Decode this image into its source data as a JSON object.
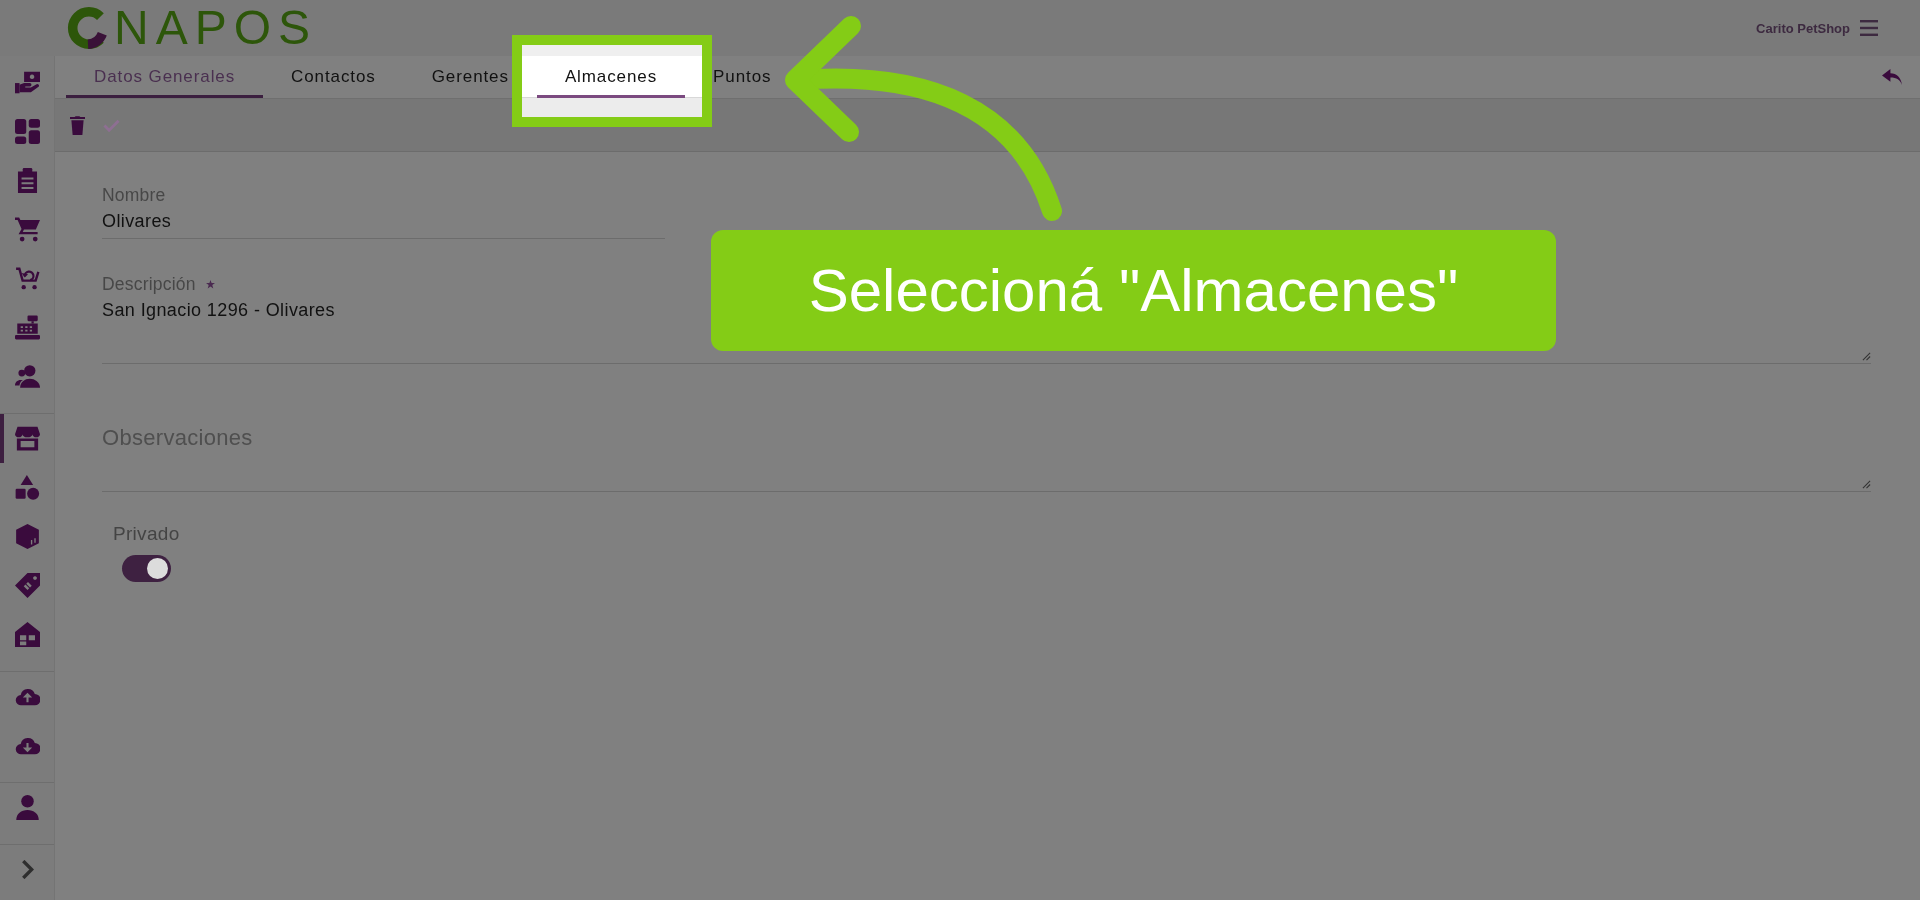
{
  "header": {
    "logo": "NAPOS",
    "account": "Carito PetShop"
  },
  "sidebar": {
    "groups": [
      {
        "items": [
          {
            "selected": false
          },
          {
            "selected": false
          },
          {
            "selected": false
          },
          {
            "selected": false
          },
          {
            "selected": false
          },
          {
            "selected": false
          },
          {
            "selected": false
          }
        ]
      },
      {
        "items": [
          {
            "selected": true
          },
          {
            "selected": false
          },
          {
            "selected": false
          },
          {
            "selected": false
          },
          {
            "selected": false
          }
        ]
      },
      {
        "items": [
          {
            "selected": false
          },
          {
            "selected": false
          }
        ]
      },
      {
        "items": [
          {
            "selected": false
          }
        ]
      }
    ]
  },
  "tabs": [
    {
      "label": "Datos Generales",
      "selected": true,
      "highlighted": false
    },
    {
      "label": "Contactos",
      "selected": false,
      "highlighted": false
    },
    {
      "label": "Gerentes",
      "selected": false,
      "highlighted": false
    },
    {
      "label": "Almacenes",
      "selected": false,
      "highlighted": true
    },
    {
      "label": "Puntos",
      "selected": false,
      "highlighted": false
    }
  ],
  "toolbar": {
    "buttons": [
      {
        "disabled": false
      },
      {
        "disabled": true
      }
    ]
  },
  "form": {
    "fields": [
      {
        "kind": "input",
        "label": "Nombre",
        "required": false,
        "value": "Olivares"
      },
      {
        "kind": "textarea",
        "label": "Descripción",
        "required": true,
        "value": "San Ignacio 1296 - Olivares"
      },
      {
        "kind": "textarea",
        "required": false,
        "placeholder": "Observaciones"
      }
    ],
    "toggle": {
      "label": "Privado",
      "on": true
    }
  },
  "tutorial": {
    "callout": "Seleccioná \"Almacenes\""
  }
}
